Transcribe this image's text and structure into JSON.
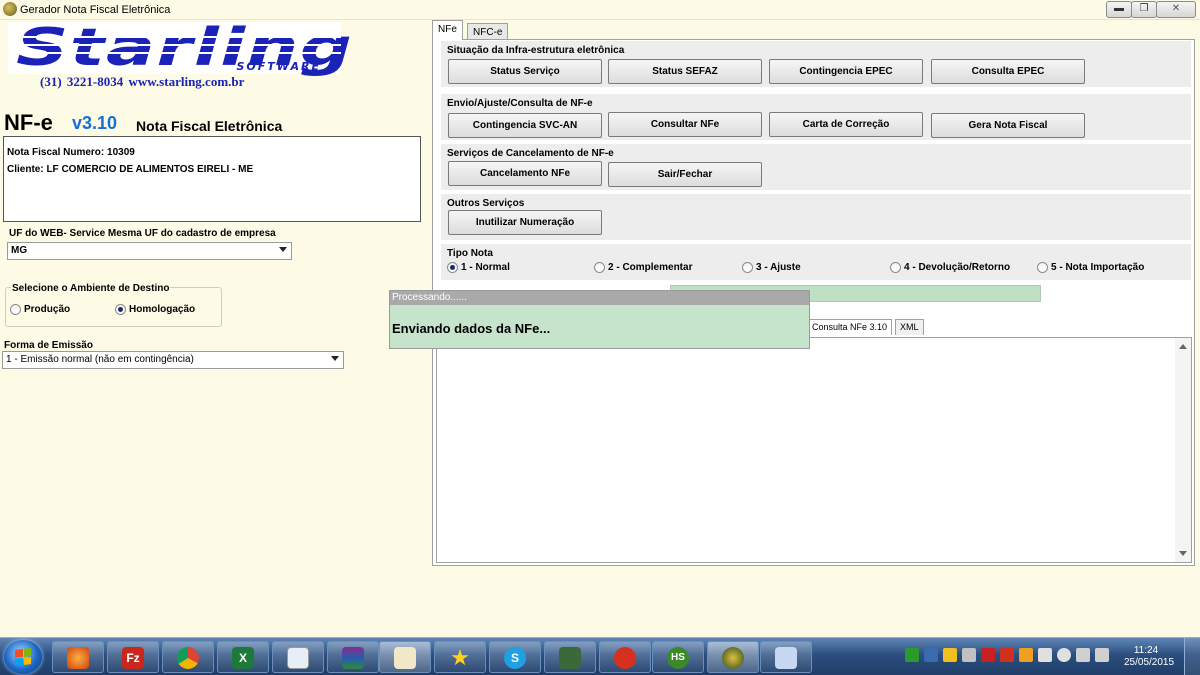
{
  "window": {
    "title": "Gerador Nota Fiscal Eletrônica",
    "controls": {
      "minimize": "▬",
      "maximize": "❐",
      "close": "✕"
    }
  },
  "logo": {
    "word": "Starling",
    "tagline": "SOFTWARE",
    "contact": "(31) 3221-8034   www.starling.com.br"
  },
  "product": {
    "name": "NF-e",
    "version": "v3.10",
    "subtitle": "Nota Fiscal Eletrônica"
  },
  "info": {
    "nota_line": "Nota Fiscal Numero: 10309",
    "cliente_line": "Cliente: LF COMERCIO DE ALIMENTOS EIRELI - ME"
  },
  "uf": {
    "label": "UF do WEB- Service Mesma UF do cadastro de empresa",
    "value": "MG"
  },
  "ambiente": {
    "label": "Selecione o Ambiente de Destino",
    "options": [
      "Produção",
      "Homologação"
    ],
    "selected": 1
  },
  "emissao": {
    "label": "Forma de Emissão",
    "value": "1 - Emissão normal (não em contingência)"
  },
  "tabs": [
    "NFe",
    "NFC-e"
  ],
  "sections": {
    "infra": {
      "title": "Situação da Infra-estrutura eletrônica",
      "buttons": [
        "Status Serviço",
        "Status SEFAZ",
        "Contingencia EPEC",
        "Consulta EPEC"
      ]
    },
    "envio": {
      "title": "Envio/Ajuste/Consulta de NF-e",
      "buttons": [
        "Contingencia SVC-AN",
        "Consultar NFe",
        "Carta de Correção",
        "Gera Nota Fiscal"
      ]
    },
    "cancel": {
      "title": "Serviços de Cancelamento de NF-e",
      "buttons": [
        "Cancelamento NFe",
        "Sair/Fechar"
      ]
    },
    "outros": {
      "title": "Outros Serviços",
      "buttons": [
        "Inutilizar Numeração"
      ]
    },
    "tipo": {
      "title": "Tipo Nota",
      "options": [
        "1 - Normal",
        "2 - Complementar",
        "3 - Ajuste",
        "4 - Devolução/Retorno",
        "5 - Nota Importação"
      ],
      "selected": 0
    }
  },
  "subtabs": [
    "Consulta NFe 3.10",
    "XML"
  ],
  "processing": {
    "header": "Processando......",
    "message": "Enviando dados da NFe..."
  },
  "taskbar": {
    "apps": [
      "firefox-icon",
      "filezilla-icon",
      "chrome-icon",
      "excel-icon",
      "window-app-icon",
      "winrar-icon",
      "notepad-icon",
      "star-icon",
      "skype-icon",
      "monitor-icon",
      "app-red-icon",
      "hs-icon",
      "globe-icon",
      "paint-icon"
    ],
    "time": "11:24",
    "date": "25/05/2015"
  }
}
